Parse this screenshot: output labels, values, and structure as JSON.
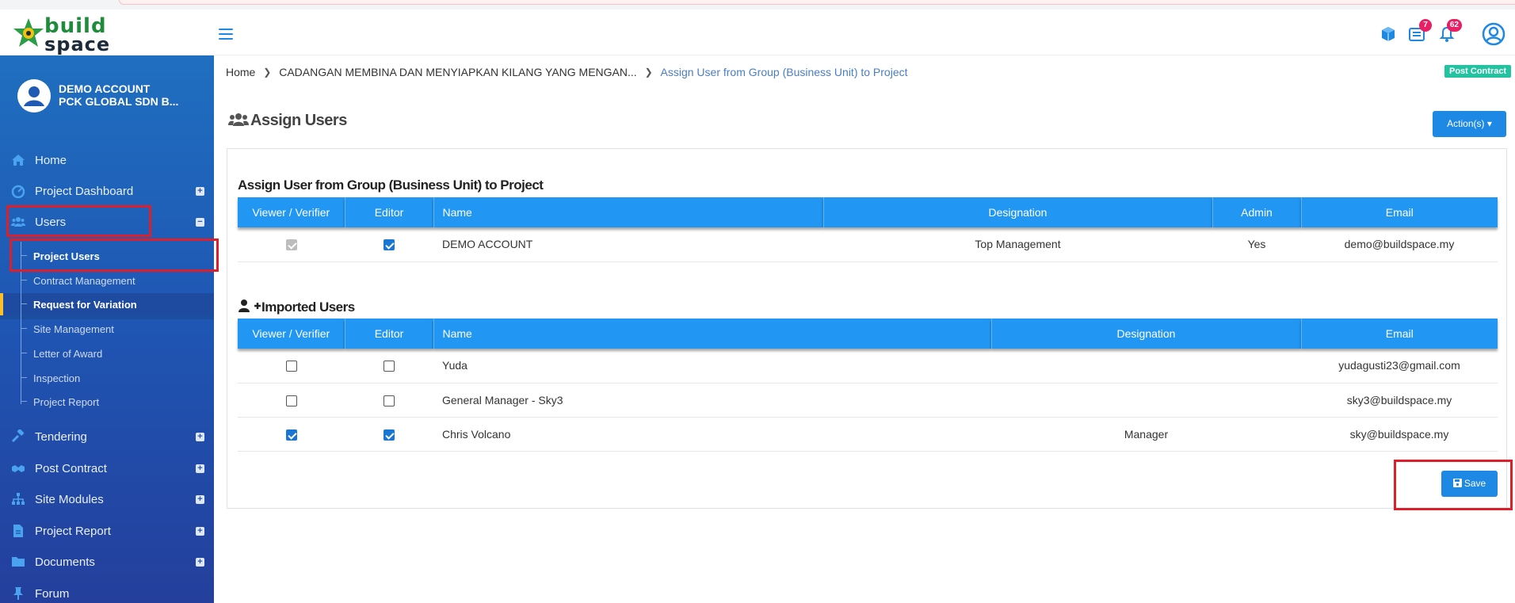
{
  "brand": {
    "line1": "build",
    "line2": "space",
    "tm": "™"
  },
  "topbar": {
    "cube_icon": "cube-icon",
    "tasks_badge": "7",
    "notifications_badge": "62",
    "user_icon": "user-circle-icon"
  },
  "sidebar": {
    "account_name": "DEMO ACCOUNT",
    "company_name": "PCK GLOBAL SDN B...",
    "items": [
      {
        "label": "Home",
        "icon": "home-icon"
      },
      {
        "label": "Project Dashboard",
        "icon": "dashboard-icon",
        "toggle": "+"
      },
      {
        "label": "Users",
        "icon": "users-icon",
        "toggle": "−"
      },
      {
        "label": "Tendering",
        "icon": "gavel-icon",
        "toggle": "+"
      },
      {
        "label": "Post Contract",
        "icon": "handshake-icon",
        "toggle": "+"
      },
      {
        "label": "Site Modules",
        "icon": "sitemap-icon",
        "toggle": "+"
      },
      {
        "label": "Project Report",
        "icon": "file-icon",
        "toggle": "+"
      },
      {
        "label": "Documents",
        "icon": "folder-icon",
        "toggle": "+"
      },
      {
        "label": "Forum",
        "icon": "pin-icon"
      }
    ],
    "subitems": [
      "Project Users",
      "Contract Management",
      "Request for Variation",
      "Site Management",
      "Letter of Award",
      "Inspection",
      "Project Report"
    ]
  },
  "breadcrumb": {
    "home": "Home",
    "project": "CADANGAN MEMBINA DAN MENYIAPKAN KILANG YANG MENGAN...",
    "current": "Assign User from Group (Business Unit) to Project"
  },
  "status_badge": "Post Contract",
  "page_title": "Assign Users",
  "action_button": "Action(s) ▾",
  "group_section": {
    "title": "Assign User from Group (Business Unit) to Project",
    "headers": [
      "Viewer / Verifier",
      "Editor",
      "Name",
      "Designation",
      "Admin",
      "Email"
    ],
    "rows": [
      {
        "viewer": "disabled",
        "editor": true,
        "name": "DEMO ACCOUNT",
        "designation": "Top Management",
        "admin": "Yes",
        "email": "demo@buildspace.my"
      }
    ]
  },
  "imported_section": {
    "title": "Imported Users",
    "headers": [
      "Viewer / Verifier",
      "Editor",
      "Name",
      "Designation",
      "Email"
    ],
    "rows": [
      {
        "viewer": false,
        "editor": false,
        "name": "Yuda",
        "designation": "",
        "email": "yudagusti23@gmail.com"
      },
      {
        "viewer": false,
        "editor": false,
        "name": "General Manager - Sky3",
        "designation": "",
        "email": "sky3@buildspace.my"
      },
      {
        "viewer": true,
        "editor": true,
        "name": "Chris Volcano",
        "designation": "Manager",
        "email": "sky@buildspace.my"
      }
    ]
  },
  "save_button": "Save",
  "colors": {
    "primary": "#2196f3",
    "sidebar": "#1f5bb5",
    "highlight": "#dc1f2a",
    "badge": "#22c3a0"
  }
}
